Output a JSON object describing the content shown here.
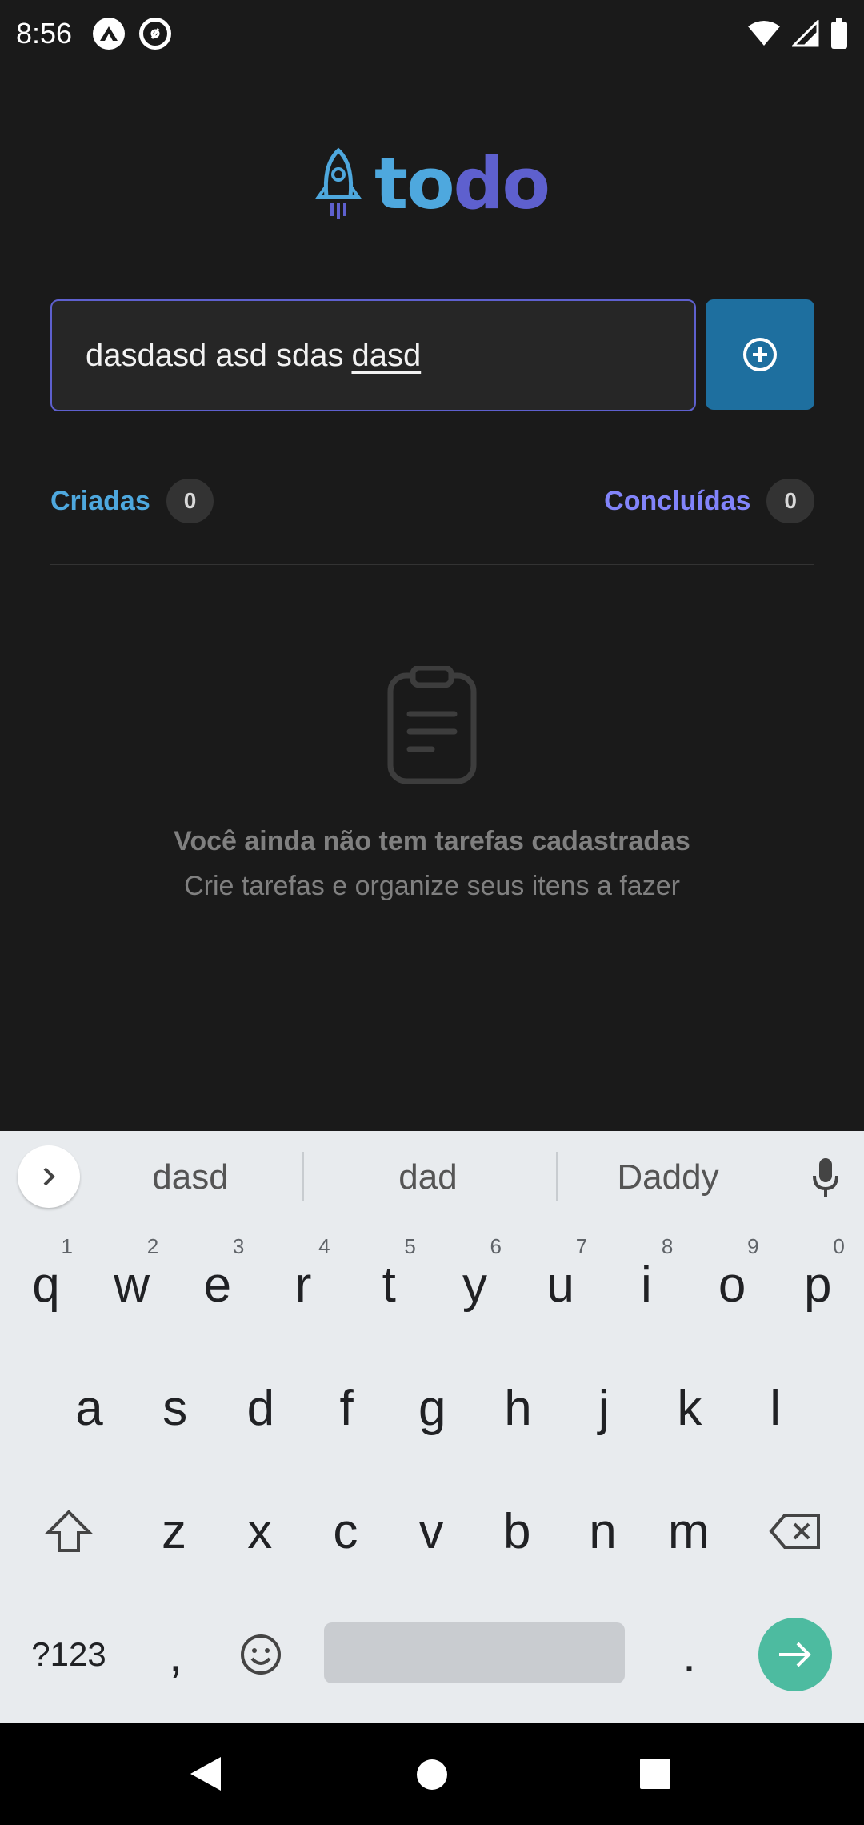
{
  "status_bar": {
    "time": "8:56"
  },
  "logo": {
    "part1": "to",
    "part2": "do"
  },
  "task_input": {
    "value_plain": "dasdasd asd sdas",
    "value_underlined": "dasd"
  },
  "counters": {
    "created_label": "Criadas",
    "created_count": "0",
    "done_label": "Concluídas",
    "done_count": "0"
  },
  "empty_state": {
    "title": "Você ainda não tem tarefas cadastradas",
    "subtitle": "Crie tarefas e organize seus itens a fazer"
  },
  "keyboard": {
    "suggestions": [
      "dasd",
      "dad",
      "Daddy"
    ],
    "row1": [
      {
        "k": "q",
        "h": "1"
      },
      {
        "k": "w",
        "h": "2"
      },
      {
        "k": "e",
        "h": "3"
      },
      {
        "k": "r",
        "h": "4"
      },
      {
        "k": "t",
        "h": "5"
      },
      {
        "k": "y",
        "h": "6"
      },
      {
        "k": "u",
        "h": "7"
      },
      {
        "k": "i",
        "h": "8"
      },
      {
        "k": "o",
        "h": "9"
      },
      {
        "k": "p",
        "h": "0"
      }
    ],
    "row2": [
      "a",
      "s",
      "d",
      "f",
      "g",
      "h",
      "j",
      "k",
      "l"
    ],
    "row3": [
      "z",
      "x",
      "c",
      "v",
      "b",
      "n",
      "m"
    ],
    "symbols_label": "?123",
    "comma": ",",
    "period": "."
  },
  "colors": {
    "accent_blue": "#4ea8de",
    "accent_purple": "#5e60ce",
    "button_blue": "#1e6f9f",
    "enter_green": "#4dbba0"
  }
}
